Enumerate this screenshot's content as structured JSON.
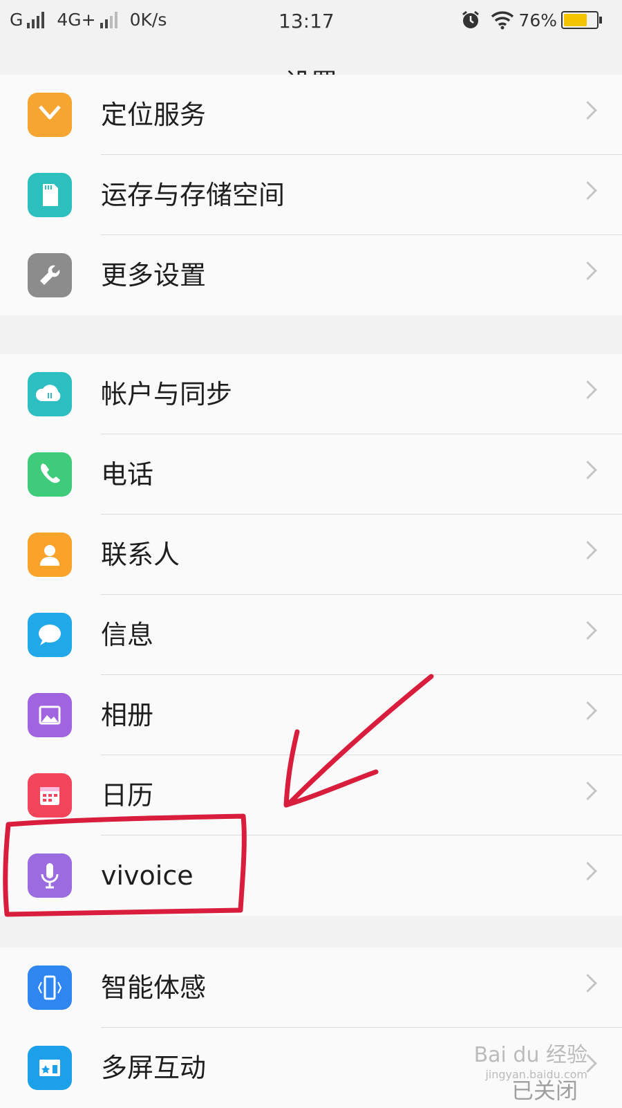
{
  "status_bar": {
    "carrier1": "G",
    "carrier2": "4G+",
    "speed": "0K/s",
    "time": "13:17",
    "battery": "76%",
    "battery_level": 0.76
  },
  "header": {
    "title": "设置"
  },
  "groups": [
    {
      "items": [
        {
          "label": "定位服务",
          "icon": "location-icon",
          "color": "#f7a531"
        },
        {
          "label": "运存与存储空间",
          "icon": "sd-card-icon",
          "color": "#2dbfbd"
        },
        {
          "label": "更多设置",
          "icon": "wrench-icon",
          "color": "#8c8c8c"
        }
      ]
    },
    {
      "items": [
        {
          "label": "帐户与同步",
          "icon": "cloud-sync-icon",
          "color": "#2cbec0"
        },
        {
          "label": "电话",
          "icon": "phone-icon",
          "color": "#3ecb7a"
        },
        {
          "label": "联系人",
          "icon": "contact-icon",
          "color": "#f9a32b"
        },
        {
          "label": "信息",
          "icon": "message-icon",
          "color": "#21a8e8"
        },
        {
          "label": "相册",
          "icon": "gallery-icon",
          "color": "#a164e0"
        },
        {
          "label": "日历",
          "icon": "calendar-icon",
          "color": "#f2445a"
        },
        {
          "label": "vivoice",
          "icon": "microphone-icon",
          "color": "#9b6be0"
        }
      ]
    },
    {
      "items": [
        {
          "label": "智能体感",
          "icon": "smart-motion-icon",
          "color": "#2f86f0"
        },
        {
          "label": "多屏互动",
          "icon": "multi-screen-icon",
          "color": "#1ca0ea"
        }
      ]
    }
  ],
  "watermark": {
    "logo": "Bai du 经验",
    "site": "jingyan.baidu.com",
    "closed": "已关闭"
  },
  "colors": {
    "annotation": "#d81e3c"
  }
}
